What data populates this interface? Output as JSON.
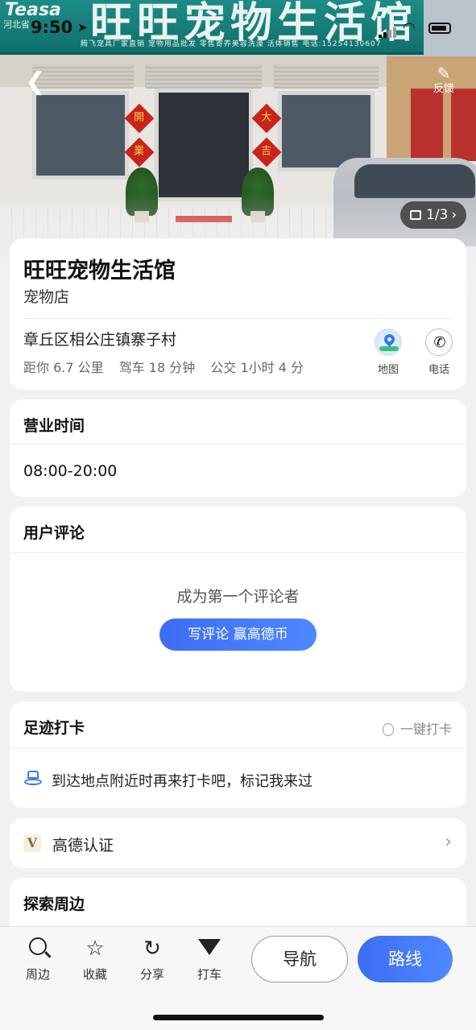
{
  "status_bar": {
    "time": "9:50"
  },
  "hero": {
    "sign_title": "旺旺宠物生活馆",
    "sign_subtitle": "腾飞宠具厂家直销   宠物用品批发   零售寄养美容洗澡   活体销售   电话:15254130607",
    "sign_logo": "Teasa",
    "sign_left_small": "河北省"
  },
  "header": {
    "feedback_label": "反馈",
    "photo_counter": "1/3"
  },
  "poi": {
    "name": "旺旺宠物生活馆",
    "category": "宠物店",
    "address": "章丘区相公庄镇寨子村",
    "distance": "距你 6.7 公里",
    "drive": "驾车 18 分钟",
    "transit": "公交 1小时 4 分",
    "map_label": "地图",
    "phone_label": "电话"
  },
  "hours": {
    "title": "营业时间",
    "value": "08:00-20:00"
  },
  "reviews": {
    "title": "用户评论",
    "empty_text": "成为第一个评论者",
    "button_label": "写评论  赢高德币"
  },
  "checkin": {
    "title": "足迹打卡",
    "quick_label": "一键打卡",
    "tip": "到达地点附近时再来打卡吧，标记我来过"
  },
  "verify": {
    "badge": "V",
    "label": "高德认证"
  },
  "explore": {
    "title": "探索周边"
  },
  "bottom_bar": {
    "tabs": [
      {
        "label": "周边",
        "icon": "search-icon"
      },
      {
        "label": "收藏",
        "icon": "star-icon"
      },
      {
        "label": "分享",
        "icon": "share-icon"
      },
      {
        "label": "打车",
        "icon": "taxi-icon"
      }
    ],
    "navigate_label": "导航",
    "route_label": "路线"
  },
  "colors": {
    "accent": "#3d6df2",
    "page_bg": "#f0f1f3",
    "sign_green": "#1d8c86"
  }
}
